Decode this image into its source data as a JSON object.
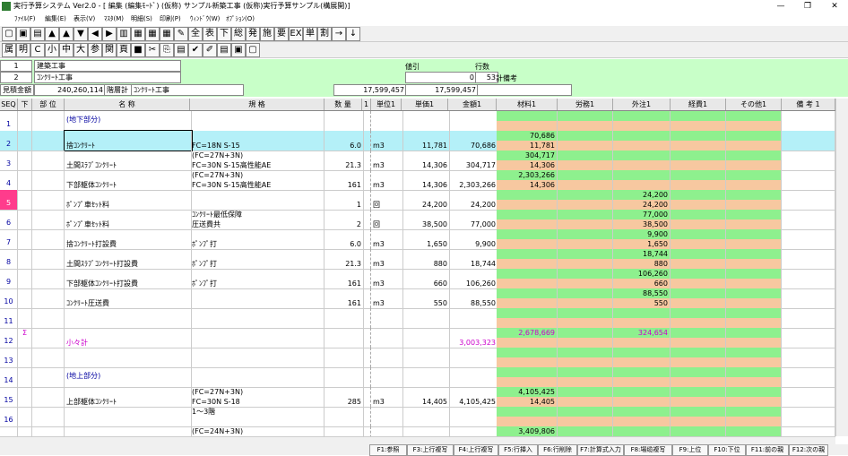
{
  "window": {
    "title": "実行予算システム Ver2.0 - [ 編集 (編集ﾓｰﾄﾞ) (仮称) サンプル新築工事 (仮称)実行予算サンプル(構展開)]",
    "min": "—",
    "max": "❐",
    "close": "✕"
  },
  "menu": [
    "ﾌｧｲﾙ(F)",
    "編集(E)",
    "表示(V)",
    "ﾏｽﾀ(M)",
    "明細(S)",
    "印刷(P)",
    "ｳｨﾝﾄﾞｳ(W)",
    "ｵﾌﾟｼｮﾝ(O)"
  ],
  "toolbar1": [
    "▢",
    "▣",
    "▤",
    "▲",
    "▲",
    "▼",
    "◀",
    "▶",
    "▥",
    "▦",
    "▦",
    "▦",
    "✎",
    "全",
    "表",
    "下",
    "総",
    "発",
    "施",
    "要",
    "EX",
    "単",
    "割",
    "→",
    "↓"
  ],
  "toolbar2": [
    "属",
    "明",
    "C",
    "小",
    "中",
    "大",
    "参",
    "関",
    "頁",
    "■",
    "✂",
    "⎘",
    "▤",
    "✔",
    "✐",
    "▤",
    "▣",
    "▢"
  ],
  "header": {
    "row1_no": "1",
    "row1_name": "建築工事",
    "row2_no": "2",
    "row2_name": "ｺﾝｸﾘｰﾄ工事",
    "discount_label": "値引",
    "discount_value": "0",
    "rows_label": "行数",
    "rows_value": "53",
    "remark_label": "計備考",
    "estimate_label": "見積金額",
    "estimate_value": "240,260,114",
    "layer_label": "階層計",
    "layer_name": "ｺﾝｸﾘｰﾄ工事",
    "total1": "17,599,457",
    "total2": "17,599,457"
  },
  "columns": [
    "SEQ",
    "下",
    "部 位",
    "名 称",
    "規 格",
    "数 量",
    "1",
    "単位1",
    "単価1",
    "金額1",
    "材料1",
    "労務1",
    "外注1",
    "経費1",
    "その他1",
    "備 考 1"
  ],
  "rows": [
    {
      "seq": "1",
      "mark": "",
      "name": "(地下部分)",
      "spec": "",
      "spec2": "",
      "qty": "",
      "unit": "",
      "price": "",
      "amount": "",
      "mat_top": "",
      "mat_bot": "",
      "out_top": "",
      "out_bot": ""
    },
    {
      "seq": "2",
      "mark": "",
      "name": "捨ｺﾝｸﾘｰﾄ",
      "spec": "",
      "spec2": "FC=18N S-15",
      "qty": "6.0",
      "unit": "m3",
      "price": "11,781",
      "amount": "70,686",
      "mat_top": "70,686",
      "mat_bot": "11,781",
      "out_top": "",
      "out_bot": ""
    },
    {
      "seq": "3",
      "mark": "",
      "name": "土間ｽﾗﾌﾞｺﾝｸﾘｰﾄ",
      "spec": "(FC=27N+3N)",
      "spec2": "FC=30N S-15高性能AE",
      "qty": "21.3",
      "unit": "m3",
      "price": "14,306",
      "amount": "304,717",
      "mat_top": "304,717",
      "mat_bot": "14,306",
      "out_top": "",
      "out_bot": ""
    },
    {
      "seq": "4",
      "mark": "",
      "name": "下部躯体ｺﾝｸﾘｰﾄ",
      "spec": "(FC=27N+3N)",
      "spec2": "FC=30N S-15高性能AE",
      "qty": "161",
      "unit": "m3",
      "price": "14,306",
      "amount": "2,303,266",
      "mat_top": "2,303,266",
      "mat_bot": "14,306",
      "out_top": "",
      "out_bot": ""
    },
    {
      "seq": "5",
      "mark": "",
      "name": "ﾎﾟﾝﾌﾟ車ｾｯﾄ料",
      "spec": "",
      "spec2": "",
      "qty": "1",
      "unit": "回",
      "price": "24,200",
      "amount": "24,200",
      "mat_top": "",
      "mat_bot": "",
      "out_top": "24,200",
      "out_bot": "24,200"
    },
    {
      "seq": "6",
      "mark": "",
      "name": "ﾎﾟﾝﾌﾟ車ｾｯﾄ料",
      "spec": "ｺﾝｸﾘｰﾄ最低保障",
      "spec2": "圧送費共",
      "qty": "2",
      "unit": "回",
      "price": "38,500",
      "amount": "77,000",
      "mat_top": "",
      "mat_bot": "",
      "out_top": "77,000",
      "out_bot": "38,500"
    },
    {
      "seq": "7",
      "mark": "",
      "name": "捨ｺﾝｸﾘｰﾄ打設費",
      "spec": "",
      "spec2": "ﾎﾟﾝﾌﾟ打",
      "qty": "6.0",
      "unit": "m3",
      "price": "1,650",
      "amount": "9,900",
      "mat_top": "",
      "mat_bot": "",
      "out_top": "9,900",
      "out_bot": "1,650"
    },
    {
      "seq": "8",
      "mark": "",
      "name": "土間ｽﾗﾌﾞｺﾝｸﾘｰﾄ打設費",
      "spec": "",
      "spec2": "ﾎﾟﾝﾌﾟ打",
      "qty": "21.3",
      "unit": "m3",
      "price": "880",
      "amount": "18,744",
      "mat_top": "",
      "mat_bot": "",
      "out_top": "18,744",
      "out_bot": "880"
    },
    {
      "seq": "9",
      "mark": "",
      "name": "下部躯体ｺﾝｸﾘｰﾄ打設費",
      "spec": "",
      "spec2": "ﾎﾟﾝﾌﾟ打",
      "qty": "161",
      "unit": "m3",
      "price": "660",
      "amount": "106,260",
      "mat_top": "",
      "mat_bot": "",
      "out_top": "106,260",
      "out_bot": "660"
    },
    {
      "seq": "10",
      "mark": "",
      "name": "ｺﾝｸﾘｰﾄ圧送費",
      "spec": "",
      "spec2": "",
      "qty": "161",
      "unit": "m3",
      "price": "550",
      "amount": "88,550",
      "mat_top": "",
      "mat_bot": "",
      "out_top": "88,550",
      "out_bot": "550"
    },
    {
      "seq": "11",
      "mark": "",
      "name": "",
      "spec": "",
      "spec2": "",
      "qty": "",
      "unit": "",
      "price": "",
      "amount": "",
      "mat_top": "",
      "mat_bot": "",
      "out_top": "",
      "out_bot": ""
    },
    {
      "seq": "12",
      "mark": "Σ",
      "name": "小々計",
      "spec": "",
      "spec2": "",
      "qty": "",
      "unit": "",
      "price": "",
      "amount": "3,003,323",
      "mat_top": "2,678,669",
      "mat_bot": "",
      "out_top": "324,654",
      "out_bot": ""
    },
    {
      "seq": "13",
      "mark": "",
      "name": "",
      "spec": "",
      "spec2": "",
      "qty": "",
      "unit": "",
      "price": "",
      "amount": "",
      "mat_top": "",
      "mat_bot": "",
      "out_top": "",
      "out_bot": ""
    },
    {
      "seq": "14",
      "mark": "",
      "name": "(地上部分)",
      "spec": "",
      "spec2": "",
      "qty": "",
      "unit": "",
      "price": "",
      "amount": "",
      "mat_top": "",
      "mat_bot": "",
      "out_top": "",
      "out_bot": ""
    },
    {
      "seq": "15",
      "mark": "",
      "name": "上部躯体ｺﾝｸﾘｰﾄ",
      "spec": "(FC=27N+3N)",
      "spec2": "FC=30N S-18",
      "qty": "285",
      "unit": "m3",
      "price": "14,405",
      "amount": "4,105,425",
      "mat_top": "4,105,425",
      "mat_bot": "14,405",
      "out_top": "",
      "out_bot": ""
    },
    {
      "seq": "16",
      "mark": "",
      "name": "",
      "spec": "1～3階",
      "spec2": "",
      "qty": "",
      "unit": "",
      "price": "",
      "amount": "",
      "mat_top": "",
      "mat_bot": "",
      "out_top": "",
      "out_bot": ""
    },
    {
      "seq": "",
      "mark": "",
      "name": "",
      "spec": "(FC=24N+3N)",
      "spec2": "",
      "qty": "",
      "unit": "",
      "price": "",
      "amount": "",
      "mat_top": "3,409,806",
      "mat_bot": "",
      "out_top": "",
      "out_bot": ""
    }
  ],
  "fkeys": [
    "F1:参照",
    "F3:上行複写",
    "F4:上行複写",
    "F5:行挿入",
    "F6:行削除",
    "F7:計算式入力",
    "F8:場缆複写",
    "F9:上位",
    "F10:下位",
    "F11:前の親",
    "F12:次の親"
  ],
  "colors": {
    "green": "#8ef08e",
    "peach": "#f7c8a0",
    "selected": "#b4f0f8",
    "pink": "#ff3c8c",
    "sigma": "#cc00cc",
    "seq": "#0000a0"
  }
}
